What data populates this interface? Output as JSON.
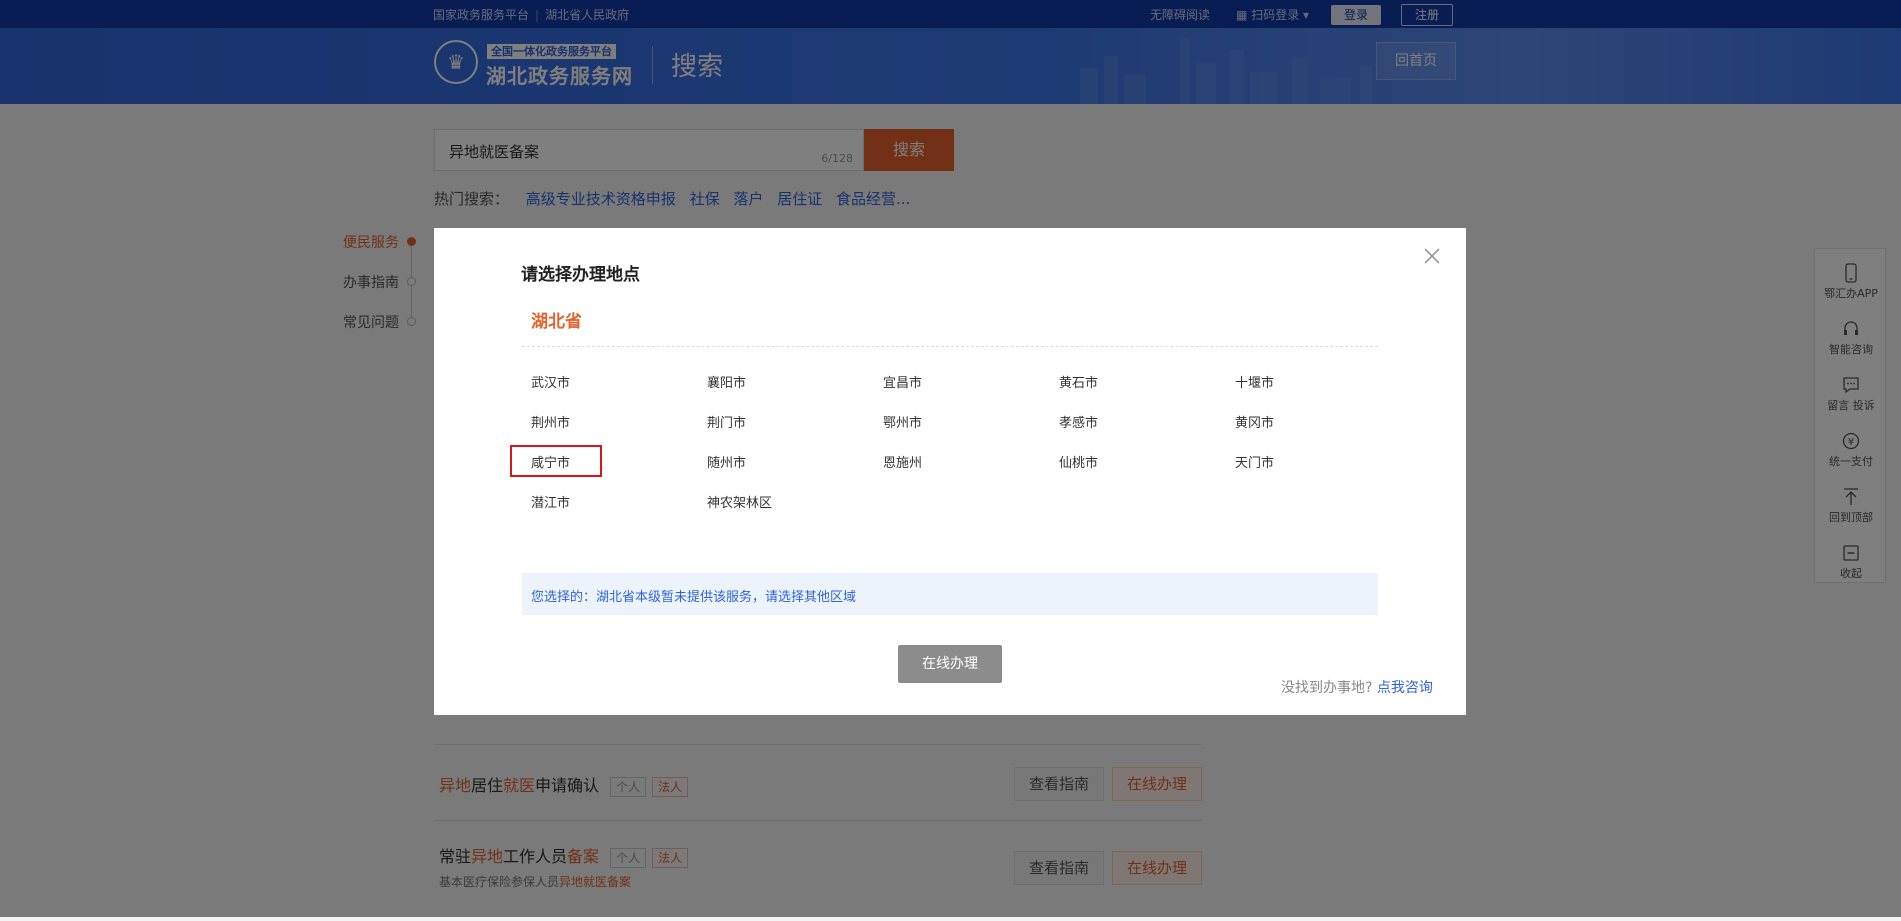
{
  "topbar": {
    "links": [
      "国家政务服务平台",
      "湖北省人民政府"
    ],
    "accessible_reading": "无障碍阅读",
    "scan_login": "扫码登录",
    "login": "登录",
    "register": "注册"
  },
  "header": {
    "logo_tagline": "全国一体化政务服务平台",
    "logo_name": "湖北政务服务网",
    "section_title": "搜索",
    "home_button": "回首页"
  },
  "search": {
    "value": "异地就医备案",
    "char_count": "6/128",
    "button": "搜索",
    "hot_label": "热门搜索：",
    "hot_keywords": [
      "高级专业技术资格申报",
      "社保",
      "落户",
      "居住证",
      "食品经营..."
    ]
  },
  "sidenav": {
    "items": [
      {
        "label": "便民服务",
        "active": true
      },
      {
        "label": "办事指南",
        "active": false
      },
      {
        "label": "常见问题",
        "active": false
      }
    ]
  },
  "results": [
    {
      "title_parts": [
        {
          "text": "异地",
          "hl": true
        },
        {
          "text": "居住",
          "hl": false
        },
        {
          "text": "就医",
          "hl": true
        },
        {
          "text": "申请确认",
          "hl": false
        }
      ],
      "tags": [
        "个人",
        "法人"
      ],
      "subtitle_parts": [],
      "guide_button": "查看指南",
      "online_button": "在线办理"
    },
    {
      "title_parts": [
        {
          "text": "常驻",
          "hl": false
        },
        {
          "text": "异地",
          "hl": true
        },
        {
          "text": "工作人员",
          "hl": false
        },
        {
          "text": "备案",
          "hl": true
        }
      ],
      "tags": [
        "个人",
        "法人"
      ],
      "subtitle_parts": [
        {
          "text": "基本医疗保险参保人员",
          "hl": false
        },
        {
          "text": "异地就医备案",
          "hl": true
        }
      ],
      "guide_button": "查看指南",
      "online_button": "在线办理"
    }
  ],
  "right_toolbar": [
    {
      "label": "鄂汇办APP",
      "icon": "phone-icon"
    },
    {
      "label": "智能咨询",
      "icon": "headset-icon"
    },
    {
      "label": "留言 投诉",
      "icon": "message-icon"
    },
    {
      "label": "统一支付",
      "icon": "yuan-icon"
    },
    {
      "label": "回到顶部",
      "icon": "arrow-up-icon"
    },
    {
      "label": "收起",
      "icon": "collapse-icon"
    }
  ],
  "modal": {
    "title": "请选择办理地点",
    "province": "湖北省",
    "cities": [
      [
        "武汉市",
        "襄阳市",
        "宜昌市",
        "黄石市",
        "十堰市"
      ],
      [
        "荆州市",
        "荆门市",
        "鄂州市",
        "孝感市",
        "黄冈市"
      ],
      [
        "咸宁市",
        "随州市",
        "恩施州",
        "仙桃市",
        "天门市"
      ],
      [
        "潜江市",
        "神农架林区"
      ]
    ],
    "highlighted_city": "咸宁市",
    "notice": "您选择的：湖北省本级暂未提供该服务，请选择其他区域",
    "online_button": "在线办理",
    "not_found_text": "没找到办事地?",
    "not_found_link": "点我咨询"
  },
  "colors": {
    "brand_blue": "#2f64d8",
    "accent_orange": "#e4632e",
    "highlight_red": "#d8141c"
  }
}
